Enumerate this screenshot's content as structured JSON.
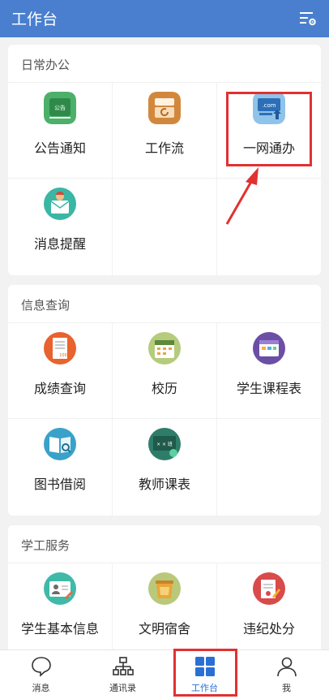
{
  "header": {
    "title": "工作台",
    "settings_icon": "settings-list-icon"
  },
  "sections": [
    {
      "title": "日常办公",
      "items": [
        {
          "label": "公告通知",
          "icon": "notice-board-icon",
          "icon_text": "公告"
        },
        {
          "label": "工作流",
          "icon": "workflow-icon"
        },
        {
          "label": "一网通办",
          "icon": "one-stop-service-icon",
          "icon_text": ".com"
        },
        {
          "label": "消息提醒",
          "icon": "message-reminder-icon"
        }
      ]
    },
    {
      "title": "信息查询",
      "items": [
        {
          "label": "成绩查询",
          "icon": "grade-query-icon",
          "icon_text": "100"
        },
        {
          "label": "校历",
          "icon": "school-calendar-icon"
        },
        {
          "label": "学生课程表",
          "icon": "student-timetable-icon"
        },
        {
          "label": "图书借阅",
          "icon": "library-borrow-icon"
        },
        {
          "label": "教师课表",
          "icon": "teacher-timetable-icon",
          "icon_text": "× × 班"
        }
      ]
    },
    {
      "title": "学工服务",
      "items": [
        {
          "label": "学生基本信息",
          "icon": "student-info-icon"
        },
        {
          "label": "文明宿舍",
          "icon": "civilized-dorm-icon"
        },
        {
          "label": "违纪处分",
          "icon": "discipline-icon"
        }
      ]
    }
  ],
  "tabs": [
    {
      "label": "消息",
      "icon": "chat-bubble-icon",
      "active": false
    },
    {
      "label": "通讯录",
      "icon": "org-chart-icon",
      "active": false
    },
    {
      "label": "工作台",
      "icon": "grid-icon",
      "active": true
    },
    {
      "label": "我",
      "icon": "person-icon",
      "active": false
    }
  ],
  "colors": {
    "header_bg": "#4a7fcf",
    "accent": "#2a6fd6",
    "highlight": "#e13131"
  }
}
